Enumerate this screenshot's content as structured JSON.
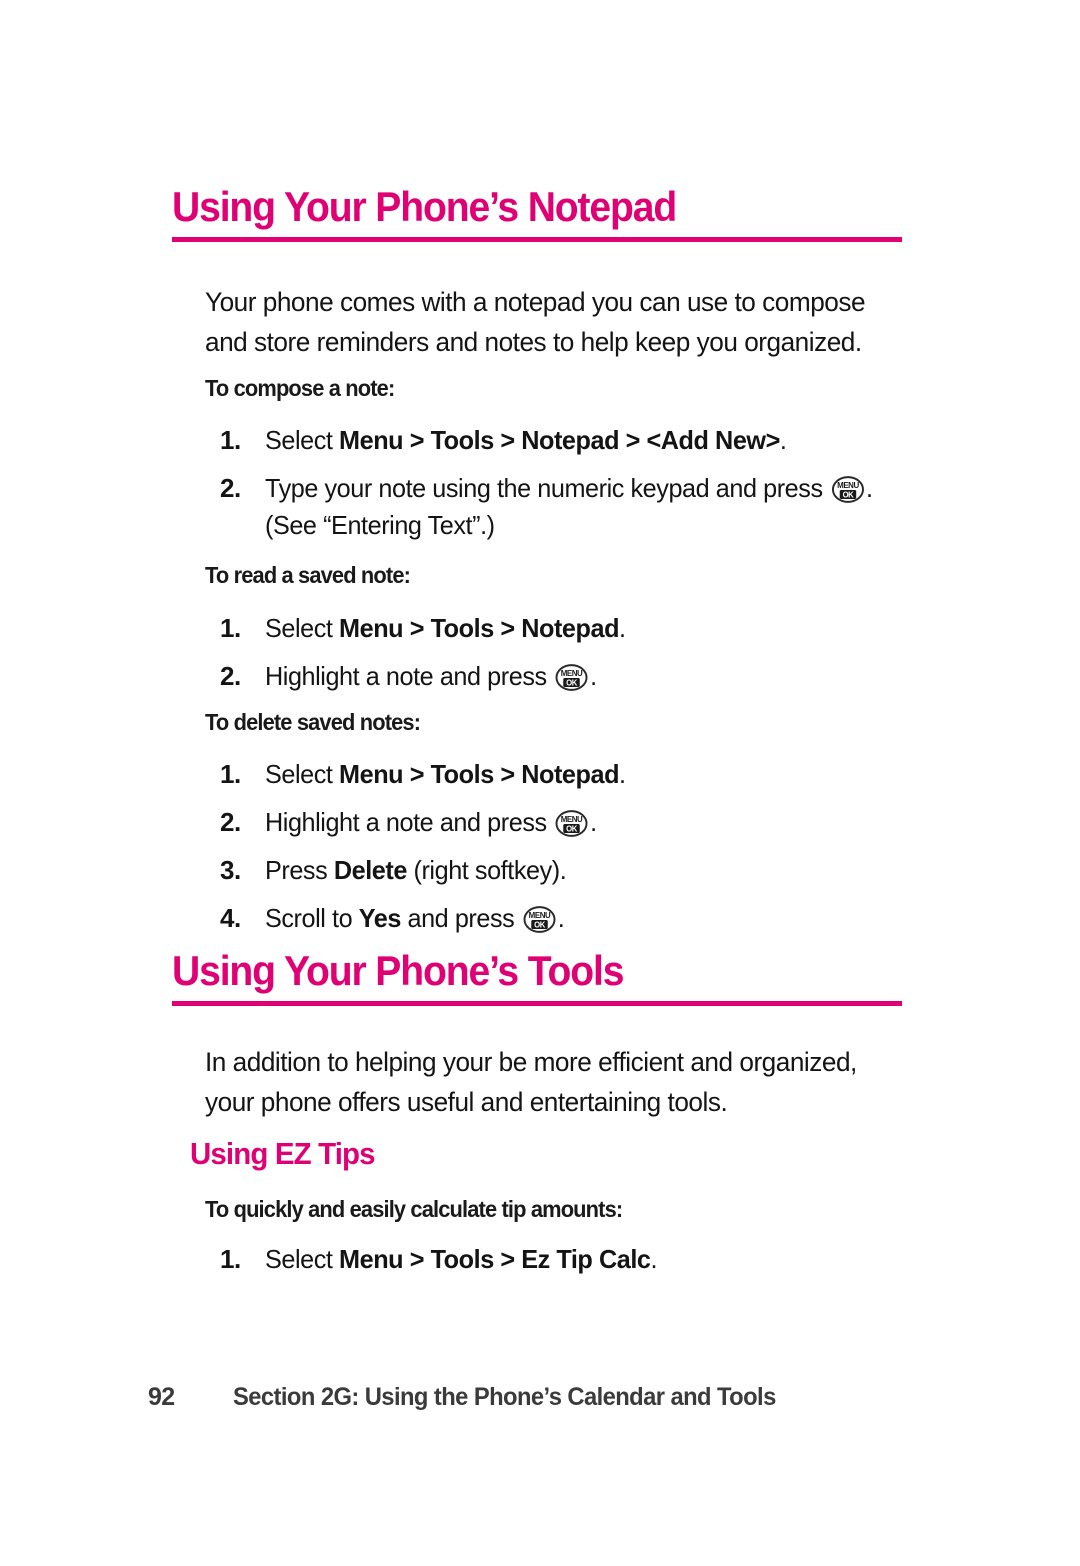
{
  "page": {
    "number": "92",
    "footer_section": "Section 2G: Using the Phone’s Calendar and Tools",
    "accent_color": "#DF0174",
    "text_color": "#141414"
  },
  "sections": [
    {
      "heading": "Using Your Phone’s Notepad",
      "intro": "Your phone comes with a notepad you can use to compose and store reminders and notes to help keep you organized.",
      "procedures": [
        {
          "lead": "To compose a note:",
          "steps": [
            {
              "num": "1.",
              "pre": "Select ",
              "bold": "Menu > Tools > Notepad > <Add New>",
              "post": ".",
              "icon": false
            },
            {
              "num": "2.",
              "pre": "Type your note using the numeric keypad and press ",
              "bold": "",
              "post": ". (See “Entering Text”.)",
              "icon": true
            }
          ]
        },
        {
          "lead": "To read a saved note:",
          "steps": [
            {
              "num": "1.",
              "pre": "Select ",
              "bold": "Menu > Tools > Notepad",
              "post": ".",
              "icon": false
            },
            {
              "num": "2.",
              "pre": "Highlight a note and press ",
              "bold": "",
              "post": ".",
              "icon": true
            }
          ]
        },
        {
          "lead": "To delete saved notes:",
          "steps": [
            {
              "num": "1.",
              "pre": "Select ",
              "bold": "Menu > Tools > Notepad",
              "post": ".",
              "icon": false
            },
            {
              "num": "2.",
              "pre": "Highlight a note and press ",
              "bold": "",
              "post": ".",
              "icon": true
            },
            {
              "num": "3.",
              "pre": "Press ",
              "bold": "Delete",
              "post": " (right softkey).",
              "icon": false
            },
            {
              "num": "4.",
              "pre": "Scroll to ",
              "bold": "Yes",
              "post": " and press ",
              "icon": true,
              "tail": "."
            }
          ]
        }
      ]
    },
    {
      "heading": "Using Your Phone’s Tools",
      "intro": "In addition to helping your be more efficient and organized, your phone offers useful and entertaining tools.",
      "subheading": "Using EZ Tips",
      "procedures": [
        {
          "lead": "To quickly and easily calculate tip amounts:",
          "steps": [
            {
              "num": "1.",
              "pre": "Select ",
              "bold": "Menu > Tools > Ez Tip Calc",
              "post": ".",
              "icon": false
            }
          ]
        }
      ]
    }
  ],
  "icons": {
    "menu_ok_key": {
      "name": "menu-ok-key-icon",
      "top_label": "MENU",
      "bottom_label": "OK"
    }
  },
  "text": {
    "h1_notepad": "Using Your Phone’s Notepad",
    "intro_notepad": "Your phone comes with a notepad you can use to compose and store reminders and notes to help keep you organized.",
    "lead_compose": "To compose a note:",
    "lead_read": "To read a saved note:",
    "lead_delete": "To delete saved notes:",
    "h1_tools": "Using Your Phone’s Tools",
    "intro_tools": "In addition to helping your be more efficient and organized, your phone offers useful and entertaining tools.",
    "h2_eztips": "Using EZ Tips",
    "lead_eztips": "To quickly and easily calculate tip amounts:",
    "n1": "1.",
    "n2": "2.",
    "n3": "3.",
    "n4": "4.",
    "s_select": "Select ",
    "b_menu_tools_notepad_addnew": "Menu > Tools > Notepad > <Add New>",
    "dot": ".",
    "s_type_note": "Type your note using the numeric keypad and press ",
    "s_see_entering_text": ". (See “Entering Text”.)",
    "b_menu_tools_notepad": "Menu > Tools > Notepad",
    "s_highlight": "Highlight a note and press ",
    "s_press": "Press ",
    "b_delete": "Delete",
    "s_right_softkey": " (right softkey).",
    "s_scroll_to": "Scroll to ",
    "b_yes": "Yes",
    "s_and_press": " and press ",
    "b_menu_tools_eztip": "Menu > Tools > Ez Tip Calc",
    "footer_page": "92",
    "footer_section": "Section 2G: Using the Phone’s Calendar and Tools"
  }
}
